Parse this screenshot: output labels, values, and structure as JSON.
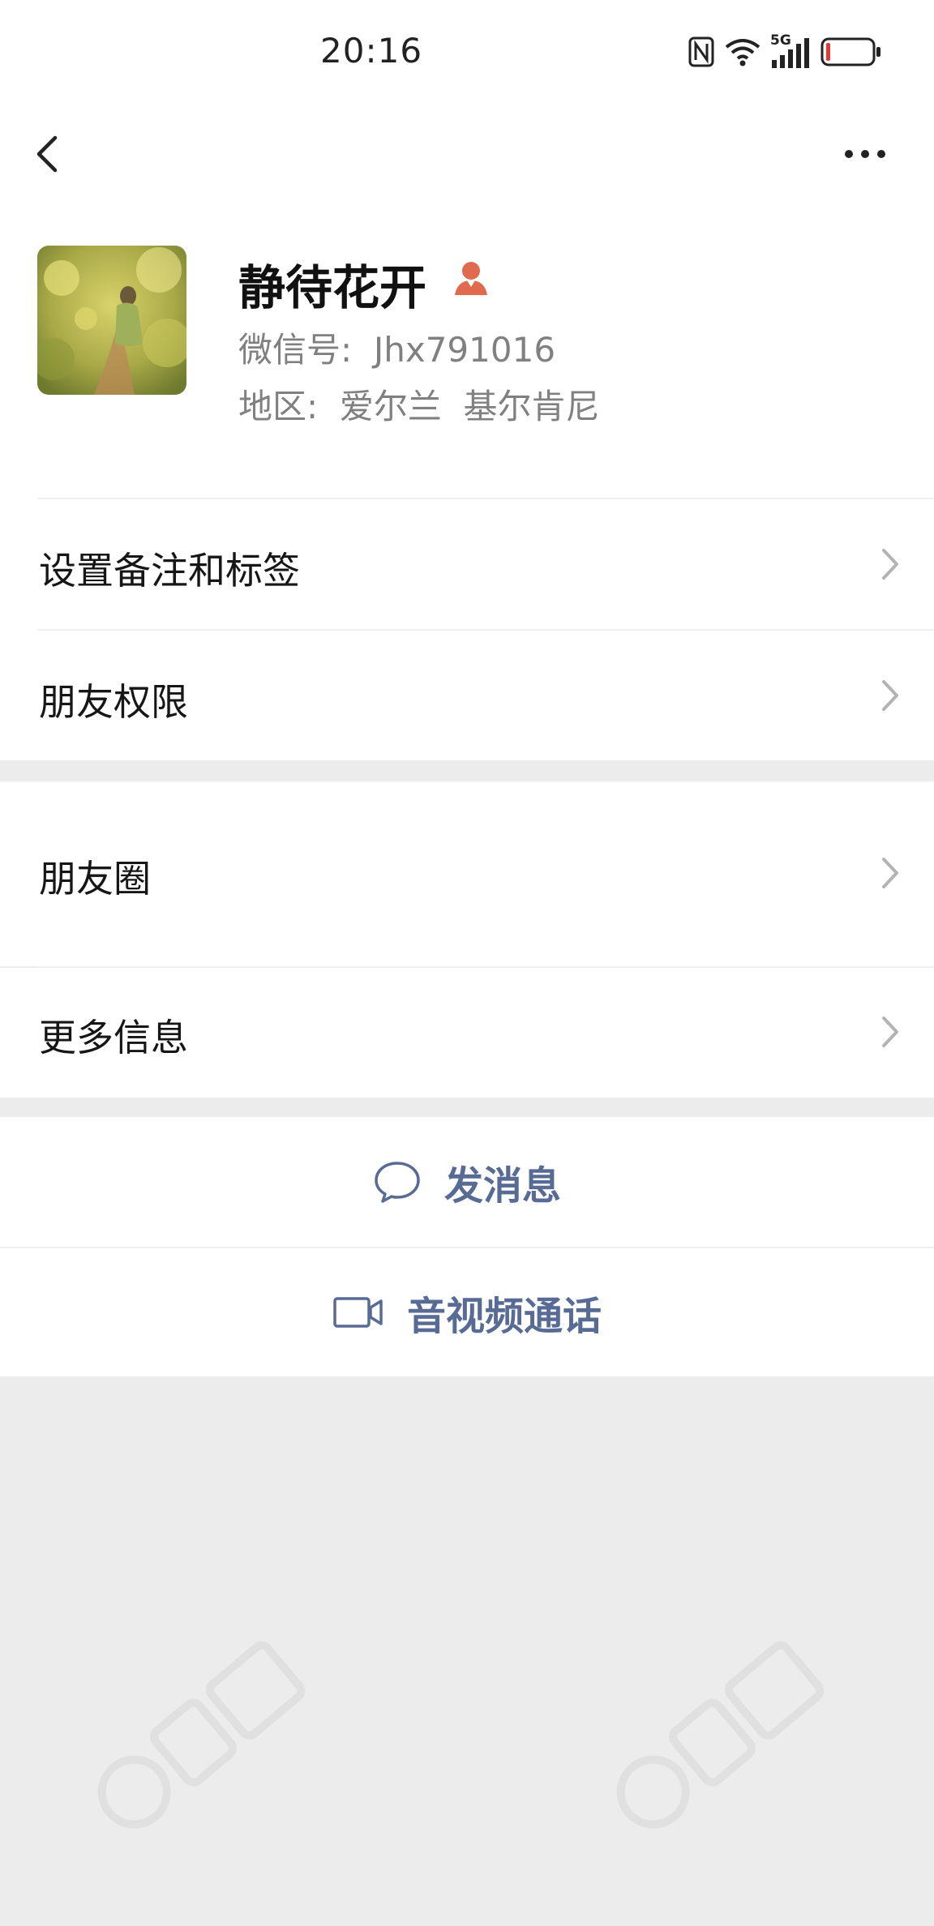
{
  "status": {
    "time": "20:16",
    "network_label": "5G"
  },
  "profile": {
    "name": "静待花开",
    "wechat_id": "微信号:  Jhx791016",
    "region": "地区:  爱尔兰  基尔肯尼",
    "gender": "female"
  },
  "menu": {
    "remarks_tags": "设置备注和标签",
    "friend_permissions": "朋友权限",
    "moments": "朋友圈",
    "more_info": "更多信息"
  },
  "actions": {
    "send_message": "发消息",
    "voice_video_call": "音视频通话"
  },
  "colors": {
    "link": "#576b95",
    "gender_female": "#e06a4e",
    "background": "#ececec"
  },
  "icons": [
    "nfc-icon",
    "wifi-icon",
    "signal-icon",
    "battery-icon",
    "back-arrow-icon",
    "more-icon",
    "female-icon",
    "chevron-right-icon",
    "chat-bubble-icon",
    "video-camera-icon"
  ]
}
